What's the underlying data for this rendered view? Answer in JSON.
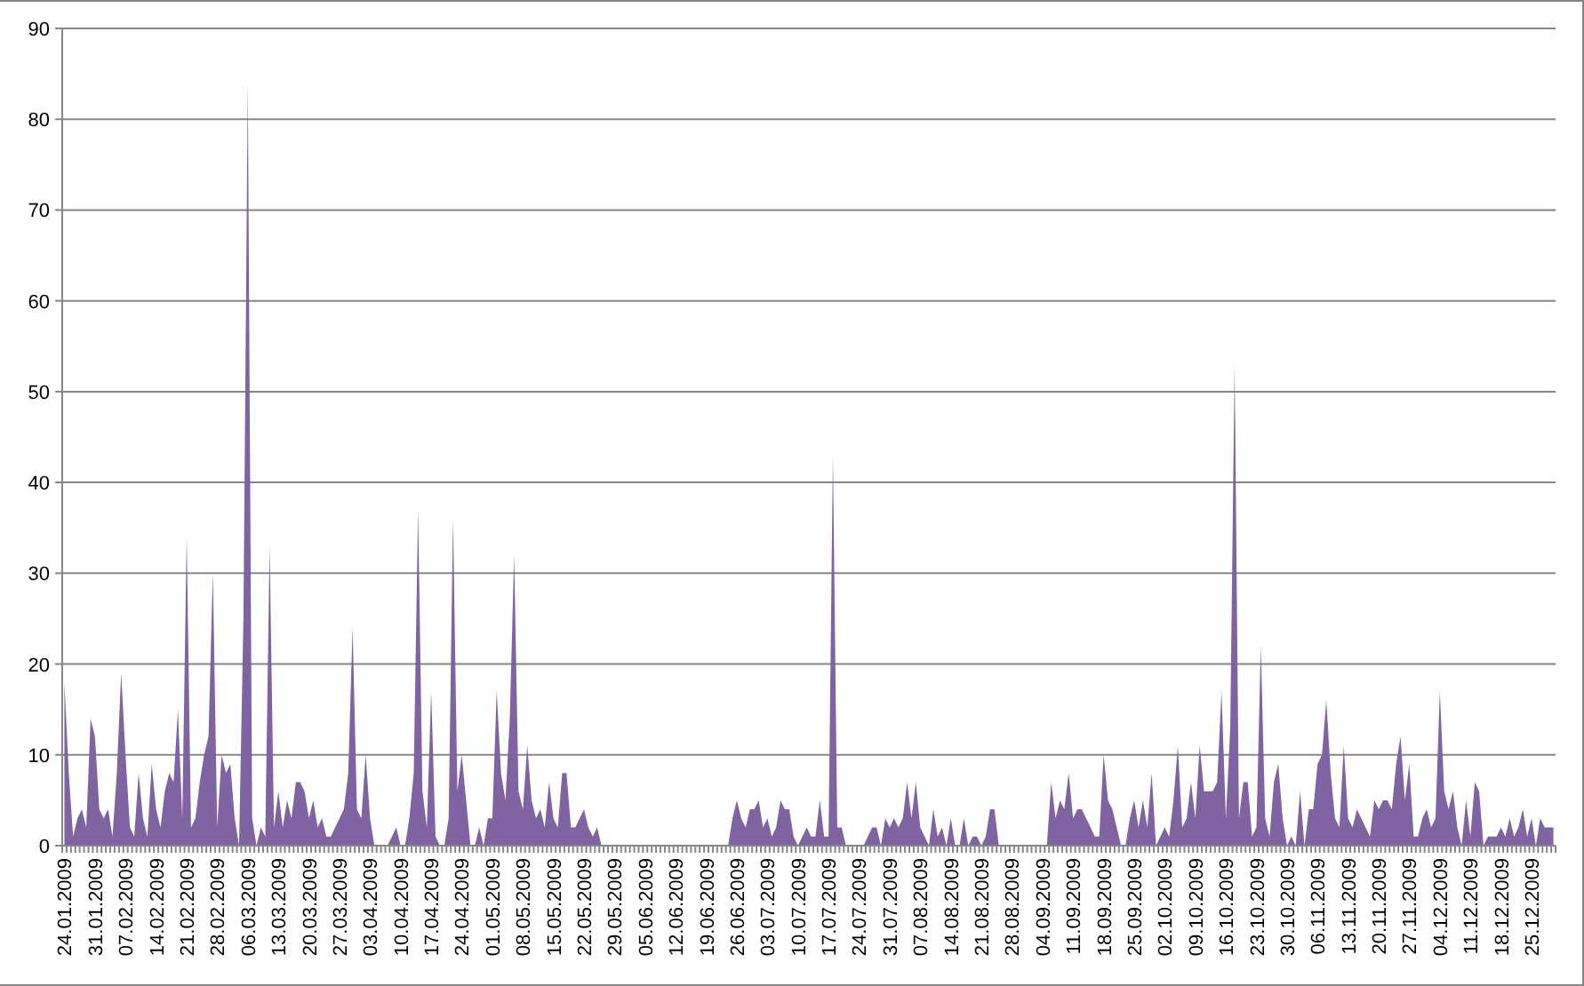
{
  "chart": {
    "chart_data": {
      "type": "area",
      "grid": true,
      "ylim": [
        0,
        90
      ],
      "yticks": [
        0,
        10,
        20,
        30,
        40,
        50,
        60,
        70,
        80,
        90
      ],
      "categories": [
        "24.01.2009",
        null,
        null,
        null,
        null,
        null,
        null,
        "31.01.2009",
        null,
        null,
        null,
        null,
        null,
        null,
        "07.02.2009",
        null,
        null,
        null,
        null,
        null,
        null,
        "14.02.2009",
        null,
        null,
        null,
        null,
        null,
        null,
        "21.02.2009",
        null,
        null,
        null,
        null,
        null,
        null,
        "28.02.2009",
        null,
        null,
        null,
        null,
        null,
        null,
        "06.03.2009",
        null,
        null,
        null,
        null,
        null,
        null,
        "13.03.2009",
        null,
        null,
        null,
        null,
        null,
        null,
        "20.03.2009",
        null,
        null,
        null,
        null,
        null,
        null,
        "27.03.2009",
        null,
        null,
        null,
        null,
        null,
        null,
        "03.04.2009",
        null,
        null,
        null,
        null,
        null,
        null,
        "10.04.2009",
        null,
        null,
        null,
        null,
        null,
        null,
        "17.04.2009",
        null,
        null,
        null,
        null,
        null,
        null,
        "24.04.2009",
        null,
        null,
        null,
        null,
        null,
        null,
        "01.05.2009",
        null,
        null,
        null,
        null,
        null,
        null,
        "08.05.2009",
        null,
        null,
        null,
        null,
        null,
        null,
        "15.05.2009",
        null,
        null,
        null,
        null,
        null,
        null,
        "22.05.2009",
        null,
        null,
        null,
        null,
        null,
        null,
        "29.05.2009",
        null,
        null,
        null,
        null,
        null,
        null,
        "05.06.2009",
        null,
        null,
        null,
        null,
        null,
        null,
        "12.06.2009",
        null,
        null,
        null,
        null,
        null,
        null,
        "19.06.2009",
        null,
        null,
        null,
        null,
        null,
        null,
        "26.06.2009",
        null,
        null,
        null,
        null,
        null,
        null,
        "03.07.2009",
        null,
        null,
        null,
        null,
        null,
        null,
        "10.07.2009",
        null,
        null,
        null,
        null,
        null,
        null,
        "17.07.2009",
        null,
        null,
        null,
        null,
        null,
        null,
        "24.07.2009",
        null,
        null,
        null,
        null,
        null,
        null,
        "31.07.2009",
        null,
        null,
        null,
        null,
        null,
        null,
        "07.08.2009",
        null,
        null,
        null,
        null,
        null,
        null,
        "14.08.2009",
        null,
        null,
        null,
        null,
        null,
        null,
        "21.08.2009",
        null,
        null,
        null,
        null,
        null,
        null,
        "28.08.2009",
        null,
        null,
        null,
        null,
        null,
        null,
        "04.09.2009",
        null,
        null,
        null,
        null,
        null,
        null,
        "11.09.2009",
        null,
        null,
        null,
        null,
        null,
        null,
        "18.09.2009",
        null,
        null,
        null,
        null,
        null,
        null,
        "25.09.2009",
        null,
        null,
        null,
        null,
        null,
        null,
        "02.10.2009",
        null,
        null,
        null,
        null,
        null,
        null,
        "09.10.2009",
        null,
        null,
        null,
        null,
        null,
        null,
        "16.10.2009",
        null,
        null,
        null,
        null,
        null,
        null,
        "23.10.2009",
        null,
        null,
        null,
        null,
        null,
        null,
        "30.10.2009",
        null,
        null,
        null,
        null,
        null,
        null,
        "06.11.2009",
        null,
        null,
        null,
        null,
        null,
        null,
        "13.11.2009",
        null,
        null,
        null,
        null,
        null,
        null,
        "20.11.2009",
        null,
        null,
        null,
        null,
        null,
        null,
        "27.11.2009",
        null,
        null,
        null,
        null,
        null,
        null,
        "04.12.2009",
        null,
        null,
        null,
        null,
        null,
        null,
        "11.12.2009",
        null,
        null,
        null,
        null,
        null,
        null,
        "18.12.2009",
        null,
        null,
        null,
        null,
        null,
        null,
        "25.12.2009",
        null,
        null,
        null,
        null,
        null
      ],
      "series": [
        {
          "color": "#8064a2",
          "values": [
            18,
            8,
            1,
            3,
            4,
            2,
            14,
            12,
            4,
            3,
            4,
            1,
            8,
            19,
            10,
            2,
            1,
            8,
            3,
            1,
            9,
            4,
            2,
            6,
            8,
            7,
            15,
            3,
            34,
            2,
            3,
            7,
            10,
            12,
            30,
            2,
            10,
            8,
            9,
            3,
            0,
            25,
            84,
            3,
            0,
            2,
            1,
            33,
            2,
            6,
            2,
            5,
            3,
            7,
            7,
            6,
            3,
            5,
            2,
            3,
            1,
            1,
            2,
            3,
            4,
            8,
            24,
            4,
            3,
            10,
            3,
            0,
            0,
            0,
            0,
            1,
            2,
            0,
            0,
            3,
            8,
            37,
            6,
            2,
            17,
            1,
            0,
            0,
            3,
            36,
            6,
            10,
            5,
            0,
            0,
            2,
            0,
            3,
            3,
            17,
            8,
            5,
            14,
            32,
            6,
            4,
            11,
            5,
            3,
            4,
            2,
            7,
            3,
            2,
            8,
            8,
            2,
            2,
            3,
            4,
            2,
            1,
            2,
            0,
            0,
            0,
            0,
            0,
            0,
            0,
            0,
            0,
            0,
            0,
            0,
            0,
            0,
            0,
            0,
            0,
            0,
            0,
            0,
            0,
            0,
            0,
            0,
            0,
            0,
            0,
            0,
            0,
            0,
            3,
            5,
            3,
            2,
            4,
            4,
            5,
            2,
            3,
            1,
            2,
            5,
            4,
            4,
            1,
            0,
            1,
            2,
            1,
            1,
            5,
            1,
            1,
            43,
            2,
            2,
            0,
            0,
            0,
            0,
            0,
            1,
            2,
            2,
            0,
            3,
            2,
            3,
            2,
            3,
            7,
            3,
            7,
            2,
            1,
            0,
            4,
            1,
            2,
            0,
            3,
            0,
            0,
            3,
            0,
            1,
            1,
            0,
            1,
            4,
            4,
            0,
            0,
            0,
            0,
            0,
            0,
            0,
            0,
            0,
            0,
            0,
            0,
            7,
            3,
            5,
            4,
            8,
            3,
            4,
            4,
            3,
            2,
            1,
            1,
            10,
            5,
            4,
            2,
            0,
            0,
            3,
            5,
            2,
            5,
            2,
            8,
            0,
            1,
            2,
            1,
            5,
            11,
            2,
            3,
            7,
            3,
            11,
            6,
            6,
            6,
            7,
            17,
            3,
            13,
            53,
            3,
            7,
            7,
            1,
            2,
            22,
            3,
            1,
            7,
            9,
            3,
            0,
            1,
            0,
            6,
            0,
            4,
            4,
            9,
            10,
            16,
            8,
            3,
            2,
            11,
            3,
            2,
            4,
            3,
            2,
            1,
            5,
            4,
            5,
            5,
            4,
            9,
            12,
            5,
            9,
            1,
            1,
            3,
            4,
            2,
            3,
            17,
            6,
            4,
            6,
            2,
            0,
            5,
            1,
            7,
            6,
            0,
            1,
            1,
            1,
            2,
            1,
            3,
            1,
            2,
            4,
            1,
            3,
            0,
            3,
            2,
            2,
            2
          ]
        }
      ]
    }
  }
}
